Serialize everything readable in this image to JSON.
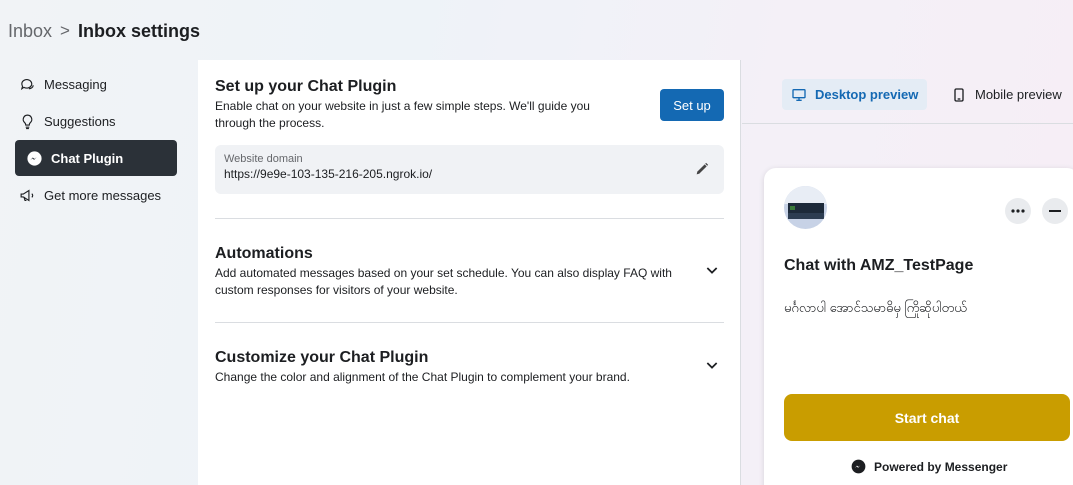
{
  "breadcrumb": {
    "parent": "Inbox",
    "separator": ">",
    "current": "Inbox settings"
  },
  "sidebar": {
    "items": [
      {
        "label": "Messaging",
        "icon": "chat-bubbles-icon"
      },
      {
        "label": "Suggestions",
        "icon": "lightbulb-icon"
      },
      {
        "label": "Chat Plugin",
        "icon": "messenger-icon",
        "active": true
      },
      {
        "label": "Get more messages",
        "icon": "megaphone-icon"
      }
    ]
  },
  "setup": {
    "title": "Set up your Chat Plugin",
    "description": "Enable chat on your website in just a few simple steps. We'll guide you through the process.",
    "button_label": "Set up",
    "domain_label": "Website domain",
    "domain_value": "https://9e9e-103-135-216-205.ngrok.io/"
  },
  "automations": {
    "title": "Automations",
    "description": "Add automated messages based on your set schedule. You can also display FAQ with custom responses for visitors of your website."
  },
  "customize": {
    "title": "Customize your Chat Plugin",
    "description": "Change the color and alignment of the Chat Plugin to complement your brand."
  },
  "preview": {
    "tabs": [
      {
        "label": "Desktop preview",
        "icon": "desktop-icon",
        "active": true
      },
      {
        "label": "Mobile preview",
        "icon": "mobile-icon",
        "active": false
      }
    ],
    "chat": {
      "title": "Chat with AMZ_TestPage",
      "greeting": "မင်္ဂလာပါ အောင်သမာဓိမှ ကြိုဆိုပါတယ်",
      "start_label": "Start chat",
      "powered_by": "Powered by Messenger"
    }
  },
  "colors": {
    "accent": "#1469b3",
    "start_button": "#c99d00",
    "active_nav": "#2b3138"
  }
}
